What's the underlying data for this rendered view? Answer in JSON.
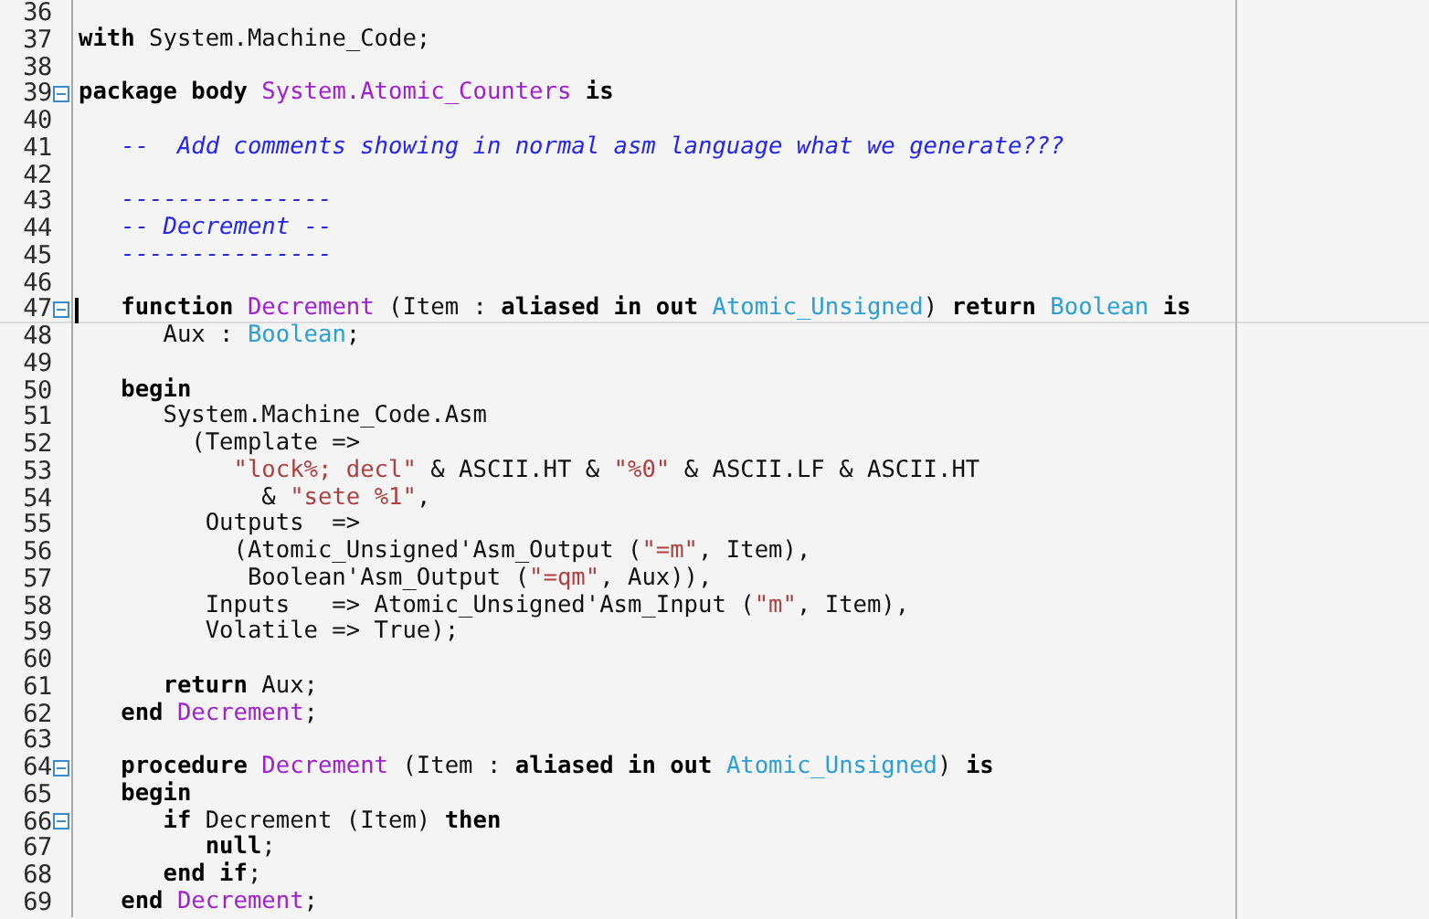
{
  "editor": {
    "lines": [
      {
        "number": "36",
        "fold_marker": false,
        "current": false
      },
      {
        "number": "37",
        "fold_marker": false,
        "current": false,
        "tokens": [
          {
            "kind": "keyword",
            "text": "with"
          },
          {
            "kind": "plain",
            "text": " System.Machine_Code;"
          }
        ]
      },
      {
        "number": "38",
        "fold_marker": false,
        "current": false
      },
      {
        "number": "39",
        "fold_marker": true,
        "current": false,
        "tokens": [
          {
            "kind": "keyword",
            "text": "package body "
          },
          {
            "kind": "name",
            "text": "System.Atomic_Counters "
          },
          {
            "kind": "keyword",
            "text": "is"
          }
        ]
      },
      {
        "number": "40",
        "fold_marker": false,
        "current": false
      },
      {
        "number": "41",
        "fold_marker": false,
        "current": false,
        "tokens": [
          {
            "kind": "comment",
            "text": "   --  Add comments showing in normal asm language what we generate???"
          }
        ]
      },
      {
        "number": "42",
        "fold_marker": false,
        "current": false
      },
      {
        "number": "43",
        "fold_marker": false,
        "current": false,
        "tokens": [
          {
            "kind": "comment",
            "text": "   ---------------"
          }
        ]
      },
      {
        "number": "44",
        "fold_marker": false,
        "current": false,
        "tokens": [
          {
            "kind": "comment",
            "text": "   -- Decrement --"
          }
        ]
      },
      {
        "number": "45",
        "fold_marker": false,
        "current": false,
        "tokens": [
          {
            "kind": "comment",
            "text": "   ---------------"
          }
        ]
      },
      {
        "number": "46",
        "fold_marker": false,
        "current": false
      },
      {
        "number": "47",
        "fold_marker": true,
        "current": true,
        "tokens": [
          {
            "kind": "keyword",
            "text": "   function "
          },
          {
            "kind": "name",
            "text": "Decrement"
          },
          {
            "kind": "plain",
            "text": " (Item : "
          },
          {
            "kind": "keyword",
            "text": "aliased in out "
          },
          {
            "kind": "type",
            "text": "Atomic_Unsigned"
          },
          {
            "kind": "plain",
            "text": ") "
          },
          {
            "kind": "keyword",
            "text": "return "
          },
          {
            "kind": "type",
            "text": "Boolean "
          },
          {
            "kind": "keyword",
            "text": "is"
          }
        ]
      },
      {
        "number": "48",
        "fold_marker": false,
        "current": false,
        "tokens": [
          {
            "kind": "plain",
            "text": "      Aux : "
          },
          {
            "kind": "type",
            "text": "Boolean"
          },
          {
            "kind": "plain",
            "text": ";"
          }
        ]
      },
      {
        "number": "49",
        "fold_marker": false,
        "current": false
      },
      {
        "number": "50",
        "fold_marker": false,
        "current": false,
        "tokens": [
          {
            "kind": "keyword",
            "text": "   begin"
          }
        ]
      },
      {
        "number": "51",
        "fold_marker": false,
        "current": false,
        "tokens": [
          {
            "kind": "plain",
            "text": "      System.Machine_Code.Asm"
          }
        ]
      },
      {
        "number": "52",
        "fold_marker": false,
        "current": false,
        "tokens": [
          {
            "kind": "plain",
            "text": "        (Template =>"
          }
        ]
      },
      {
        "number": "53",
        "fold_marker": false,
        "current": false,
        "tokens": [
          {
            "kind": "string",
            "text": "           \"lock%; decl\""
          },
          {
            "kind": "plain",
            "text": " & ASCII.HT & "
          },
          {
            "kind": "string",
            "text": "\"%0\""
          },
          {
            "kind": "plain",
            "text": " & ASCII.LF & ASCII.HT"
          }
        ]
      },
      {
        "number": "54",
        "fold_marker": false,
        "current": false,
        "tokens": [
          {
            "kind": "plain",
            "text": "             & "
          },
          {
            "kind": "string",
            "text": "\"sete %1\""
          },
          {
            "kind": "plain",
            "text": ","
          }
        ]
      },
      {
        "number": "55",
        "fold_marker": false,
        "current": false,
        "tokens": [
          {
            "kind": "plain",
            "text": "         Outputs  =>"
          }
        ]
      },
      {
        "number": "56",
        "fold_marker": false,
        "current": false,
        "tokens": [
          {
            "kind": "plain",
            "text": "           (Atomic_Unsigned'Asm_Output ("
          },
          {
            "kind": "string",
            "text": "\"=m\""
          },
          {
            "kind": "plain",
            "text": ", Item),"
          }
        ]
      },
      {
        "number": "57",
        "fold_marker": false,
        "current": false,
        "tokens": [
          {
            "kind": "plain",
            "text": "            Boolean'Asm_Output ("
          },
          {
            "kind": "string",
            "text": "\"=qm\""
          },
          {
            "kind": "plain",
            "text": ", Aux)),"
          }
        ]
      },
      {
        "number": "58",
        "fold_marker": false,
        "current": false,
        "tokens": [
          {
            "kind": "plain",
            "text": "         Inputs   => Atomic_Unsigned'Asm_Input ("
          },
          {
            "kind": "string",
            "text": "\"m\""
          },
          {
            "kind": "plain",
            "text": ", Item),"
          }
        ]
      },
      {
        "number": "59",
        "fold_marker": false,
        "current": false,
        "tokens": [
          {
            "kind": "plain",
            "text": "         Volatile => True);"
          }
        ]
      },
      {
        "number": "60",
        "fold_marker": false,
        "current": false
      },
      {
        "number": "61",
        "fold_marker": false,
        "current": false,
        "tokens": [
          {
            "kind": "keyword",
            "text": "      return"
          },
          {
            "kind": "plain",
            "text": " Aux;"
          }
        ]
      },
      {
        "number": "62",
        "fold_marker": false,
        "current": false,
        "tokens": [
          {
            "kind": "keyword",
            "text": "   end "
          },
          {
            "kind": "name",
            "text": "Decrement"
          },
          {
            "kind": "plain",
            "text": ";"
          }
        ]
      },
      {
        "number": "63",
        "fold_marker": false,
        "current": false
      },
      {
        "number": "64",
        "fold_marker": true,
        "current": false,
        "tokens": [
          {
            "kind": "keyword",
            "text": "   procedure "
          },
          {
            "kind": "name",
            "text": "Decrement"
          },
          {
            "kind": "plain",
            "text": " (Item : "
          },
          {
            "kind": "keyword",
            "text": "aliased in out "
          },
          {
            "kind": "type",
            "text": "Atomic_Unsigned"
          },
          {
            "kind": "plain",
            "text": ") "
          },
          {
            "kind": "keyword",
            "text": "is"
          }
        ]
      },
      {
        "number": "65",
        "fold_marker": false,
        "current": false,
        "tokens": [
          {
            "kind": "keyword",
            "text": "   begin"
          }
        ]
      },
      {
        "number": "66",
        "fold_marker": true,
        "current": false,
        "tokens": [
          {
            "kind": "keyword",
            "text": "      if"
          },
          {
            "kind": "plain",
            "text": " Decrement (Item) "
          },
          {
            "kind": "keyword",
            "text": "then"
          }
        ]
      },
      {
        "number": "67",
        "fold_marker": false,
        "current": false,
        "tokens": [
          {
            "kind": "keyword",
            "text": "         null"
          },
          {
            "kind": "plain",
            "text": ";"
          }
        ]
      },
      {
        "number": "68",
        "fold_marker": false,
        "current": false,
        "tokens": [
          {
            "kind": "keyword",
            "text": "      end if"
          },
          {
            "kind": "plain",
            "text": ";"
          }
        ]
      },
      {
        "number": "69",
        "fold_marker": false,
        "current": false,
        "tokens": [
          {
            "kind": "keyword",
            "text": "   end "
          },
          {
            "kind": "name",
            "text": "Decrement"
          },
          {
            "kind": "plain",
            "text": ";"
          }
        ]
      }
    ]
  }
}
